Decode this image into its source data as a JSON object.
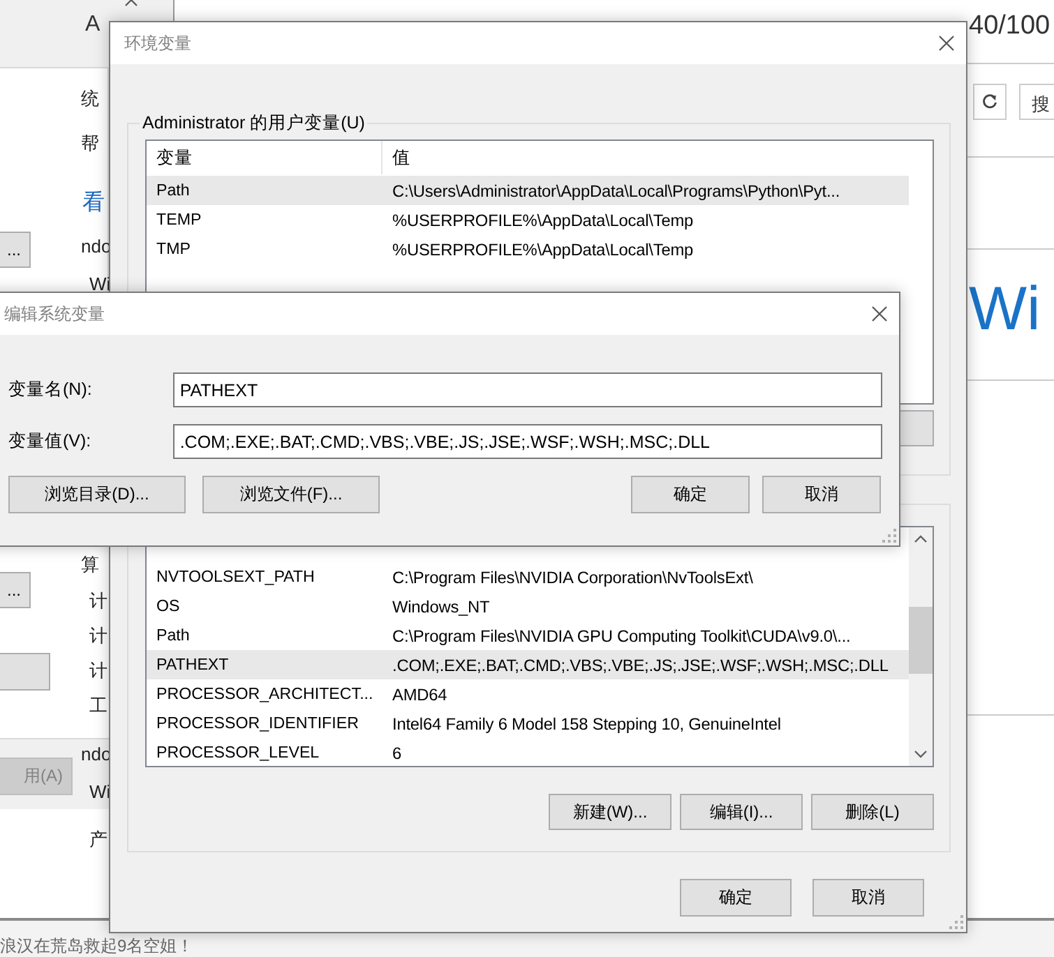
{
  "background_page": {
    "heading_fragment": "A",
    "counter": "40/100",
    "search_button": "搜",
    "brand_fragment": "Wi",
    "news_ticker": "浪汉在荒岛救起9名空姐！",
    "side_fragments": [
      {
        "text": "统",
        "kind": "text"
      },
      {
        "text": "帮",
        "kind": "text"
      },
      {
        "text": "看",
        "kind": "link"
      },
      {
        "text": "ndo",
        "kind": "text"
      },
      {
        "text": "Wi",
        "kind": "text"
      },
      {
        "text": "算",
        "kind": "text"
      },
      {
        "text": "计",
        "kind": "text"
      },
      {
        "text": "计",
        "kind": "text"
      },
      {
        "text": "计",
        "kind": "text"
      },
      {
        "text": "工",
        "kind": "text"
      },
      {
        "text": "ndo",
        "kind": "text"
      },
      {
        "text": "Wi",
        "kind": "text"
      },
      {
        "text": "产",
        "kind": "text"
      }
    ]
  },
  "system_properties_window": {
    "buttons": [
      {
        "label": "...",
        "disabled": false
      },
      {
        "label": "...",
        "disabled": false
      },
      {
        "label": "用(A)",
        "disabled": true
      }
    ]
  },
  "env_window": {
    "title": "环境变量",
    "user_group_label": "Administrator 的用户变量(U)",
    "user_columns": [
      "变量",
      "值"
    ],
    "user_variables": [
      {
        "name": "Path",
        "value": "C:\\Users\\Administrator\\AppData\\Local\\Programs\\Python\\Pyt...",
        "selected": true
      },
      {
        "name": "TEMP",
        "value": "%USERPROFILE%\\AppData\\Local\\Temp",
        "selected": false
      },
      {
        "name": "TMP",
        "value": "%USERPROFILE%\\AppData\\Local\\Temp",
        "selected": false
      }
    ],
    "system_variables": [
      {
        "name": "NVTOOLSEXT_PATH",
        "value": "C:\\Program Files\\NVIDIA Corporation\\NvToolsExt\\",
        "selected": false
      },
      {
        "name": "OS",
        "value": "Windows_NT",
        "selected": false
      },
      {
        "name": "Path",
        "value": "C:\\Program Files\\NVIDIA GPU Computing Toolkit\\CUDA\\v9.0\\...",
        "selected": false
      },
      {
        "name": "PATHEXT",
        "value": ".COM;.EXE;.BAT;.CMD;.VBS;.VBE;.JS;.JSE;.WSF;.WSH;.MSC;.DLL",
        "selected": true
      },
      {
        "name": "PROCESSOR_ARCHITECT...",
        "value": "AMD64",
        "selected": false
      },
      {
        "name": "PROCESSOR_IDENTIFIER",
        "value": "Intel64 Family 6 Model 158 Stepping 10, GenuineIntel",
        "selected": false
      },
      {
        "name": "PROCESSOR_LEVEL",
        "value": "6",
        "selected": false
      }
    ],
    "system_buttons": [
      "新建(W)...",
      "编辑(I)...",
      "删除(L)"
    ],
    "buttons": [
      "确定",
      "取消"
    ]
  },
  "edit_window": {
    "title": "编辑系统变量",
    "fields": [
      {
        "label": "变量名(N):",
        "value": "PATHEXT"
      },
      {
        "label": "变量值(V):",
        "value": ".COM;.EXE;.BAT;.CMD;.VBS;.VBE;.JS;.JSE;.WSF;.WSH;.MSC;.DLL"
      }
    ],
    "browse_buttons": [
      "浏览目录(D)...",
      "浏览文件(F)..."
    ],
    "buttons": [
      "确定",
      "取消"
    ]
  }
}
